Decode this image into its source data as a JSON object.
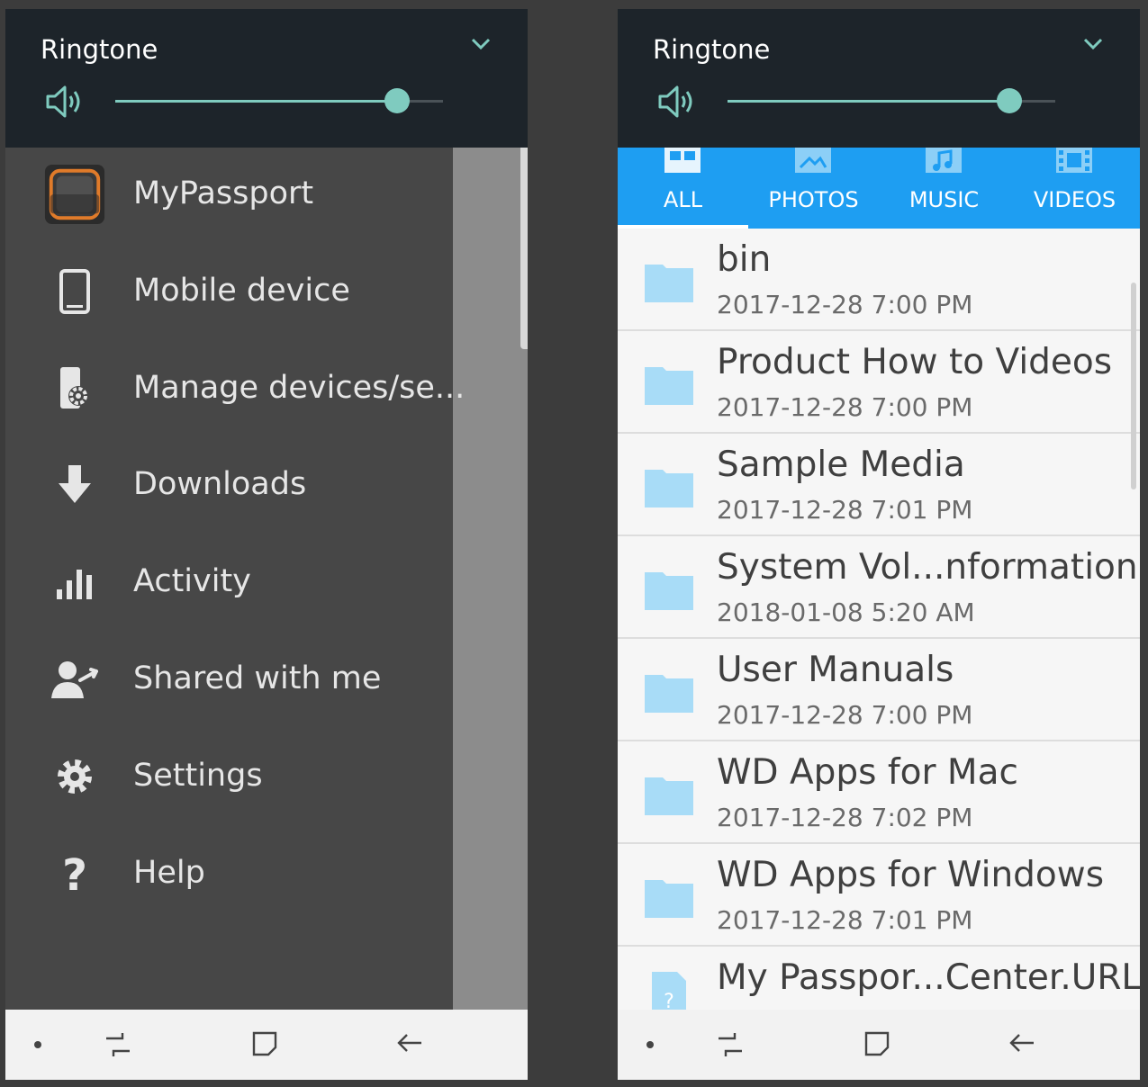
{
  "colors": {
    "panel_bg": "#1d242a",
    "accent_teal": "#7fcbbf",
    "drawer_bg": "#474747",
    "tab_blue": "#1e9ef2",
    "folder_blue": "#a8dcf7"
  },
  "left": {
    "volume": {
      "title": "Ringtone",
      "level": 0.86
    },
    "drawer": {
      "items": [
        {
          "label": "MyPassport",
          "icon": "mypassport-drive-icon"
        },
        {
          "label": "Mobile device",
          "icon": "mobile-device-icon"
        },
        {
          "label": "Manage devices/se...",
          "icon": "manage-devices-icon"
        },
        {
          "label": "Downloads",
          "icon": "download-arrow-icon"
        },
        {
          "label": "Activity",
          "icon": "activity-bars-icon"
        },
        {
          "label": "Shared with me",
          "icon": "shared-user-icon"
        },
        {
          "label": "Settings",
          "icon": "gear-icon"
        },
        {
          "label": "Help",
          "icon": "help-question-icon"
        }
      ]
    }
  },
  "right": {
    "volume": {
      "title": "Ringtone",
      "level": 0.86
    },
    "tabs": [
      {
        "label": "ALL",
        "icon": "grid-icon",
        "selected": true
      },
      {
        "label": "PHOTOS",
        "icon": "photo-icon",
        "selected": false
      },
      {
        "label": "MUSIC",
        "icon": "music-icon",
        "selected": false
      },
      {
        "label": "VIDEOS",
        "icon": "film-icon",
        "selected": false
      }
    ],
    "files": [
      {
        "name": "bin",
        "date": "2017-12-28 7:00 PM",
        "type": "folder"
      },
      {
        "name": "Product How to Videos",
        "date": "2017-12-28 7:00 PM",
        "type": "folder"
      },
      {
        "name": "Sample Media",
        "date": "2017-12-28 7:01 PM",
        "type": "folder"
      },
      {
        "name": "System Vol...nformation",
        "date": "2018-01-08 5:20 AM",
        "type": "folder"
      },
      {
        "name": "User Manuals",
        "date": "2017-12-28 7:00 PM",
        "type": "folder"
      },
      {
        "name": "WD Apps for Mac",
        "date": "2017-12-28 7:02 PM",
        "type": "folder"
      },
      {
        "name": "WD Apps for Windows",
        "date": "2017-12-28 7:01 PM",
        "type": "folder"
      },
      {
        "name": "My Passpor...Center.URL",
        "date": "",
        "type": "file"
      }
    ]
  },
  "system_nav": {
    "buttons": [
      {
        "icon": "dot-icon"
      },
      {
        "icon": "recent-apps-icon"
      },
      {
        "icon": "home-square-icon"
      },
      {
        "icon": "back-arrow-icon"
      }
    ]
  }
}
